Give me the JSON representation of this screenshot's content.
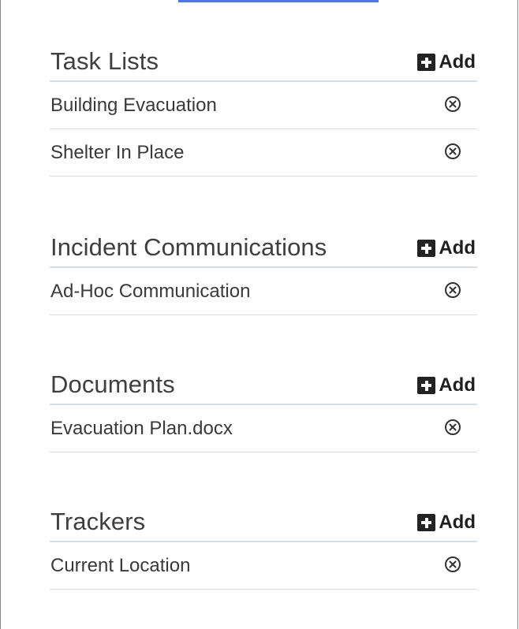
{
  "sections": [
    {
      "title": "Task Lists",
      "add_label": "Add",
      "items": [
        {
          "label": "Building Evacuation"
        },
        {
          "label": "Shelter In Place"
        }
      ]
    },
    {
      "title": "Incident Communications",
      "add_label": "Add",
      "items": [
        {
          "label": "Ad-Hoc Communication"
        }
      ]
    },
    {
      "title": "Documents",
      "add_label": "Add",
      "items": [
        {
          "label": "Evacuation Plan.docx"
        }
      ]
    },
    {
      "title": "Trackers",
      "add_label": "Add",
      "items": [
        {
          "label": "Current Location"
        }
      ]
    }
  ],
  "icons": {
    "add": "plus-square-icon",
    "remove": "circle-x-icon"
  },
  "colors": {
    "divider": "#d6dde6",
    "top_link": "#4a78f0",
    "text": "#3a3a3a"
  }
}
